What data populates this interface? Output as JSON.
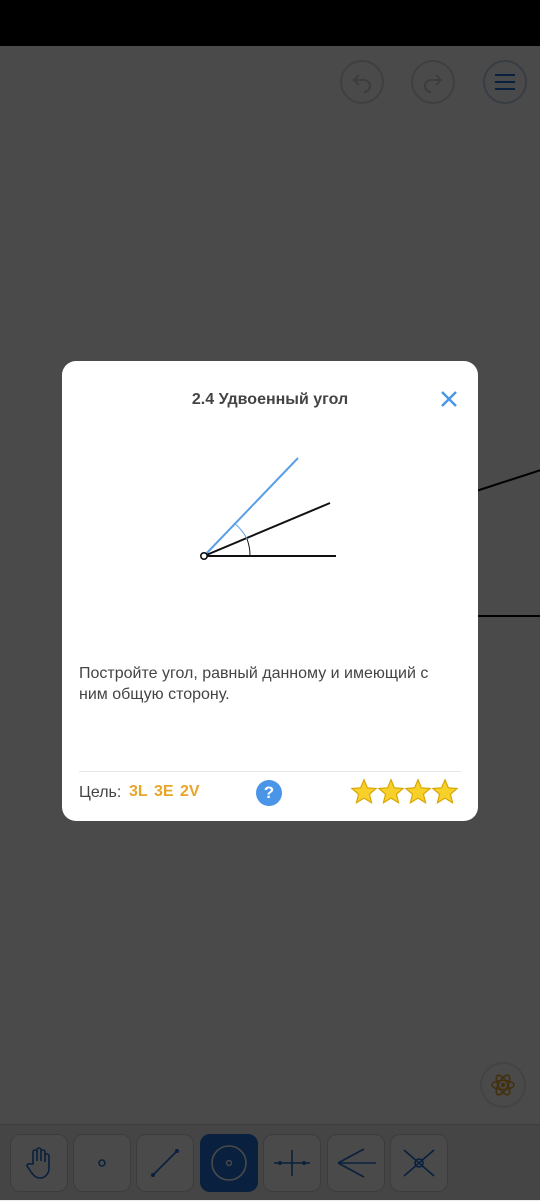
{
  "topbar": {
    "undo_icon": "undo-icon",
    "redo_icon": "redo-icon",
    "menu_icon": "hamburger-menu-icon"
  },
  "toolbar": {
    "tools": [
      {
        "name": "move",
        "icon": "hand-icon"
      },
      {
        "name": "point",
        "icon": "point-icon"
      },
      {
        "name": "line",
        "icon": "line-icon"
      },
      {
        "name": "circle",
        "icon": "circle-icon",
        "active": true
      },
      {
        "name": "perpendicular",
        "icon": "perpendicular-icon"
      },
      {
        "name": "angle-bisector",
        "icon": "angle-bisector-icon"
      },
      {
        "name": "intersection",
        "icon": "intersection-icon"
      }
    ],
    "accent": "#1f6fd4"
  },
  "hint_button": {
    "icon": "atom-icon",
    "color": "#e7a52a"
  },
  "dialog": {
    "title": "2.4 Удвоенный угол",
    "close_icon": "close-icon",
    "description": "Постройте угол, равный данному и имеющий с ним общую сторону.",
    "goal_label": "Цель:",
    "goals": [
      "3L",
      "3E",
      "2V"
    ],
    "help_label": "?",
    "stars_earned": 4,
    "stars_total": 4,
    "colors": {
      "goal": "#e7a52a",
      "help": "#4a95e8",
      "close": "#4a95e8",
      "figure_new_ray": "#5aa0e6"
    }
  }
}
